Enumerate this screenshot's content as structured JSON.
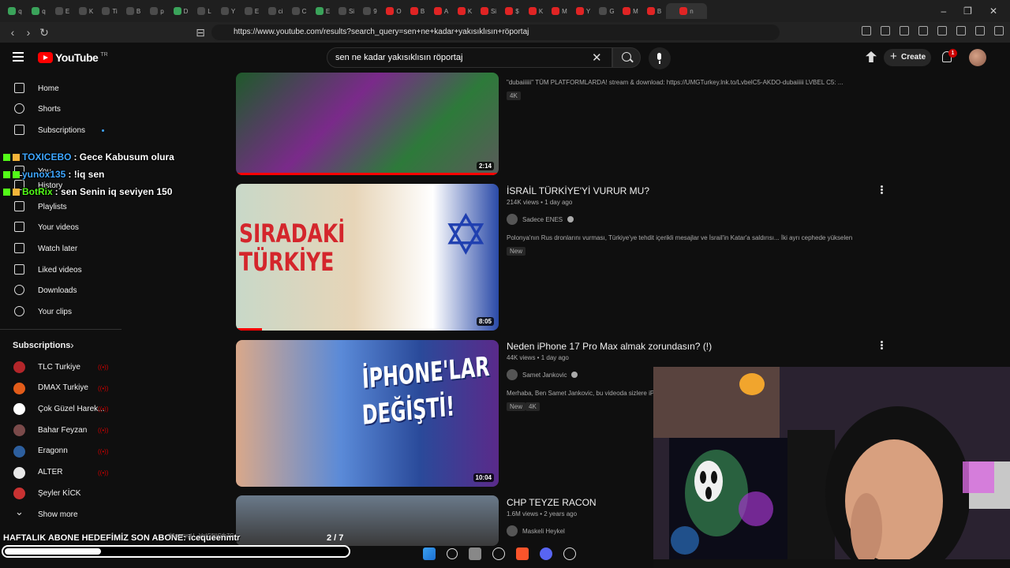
{
  "browser": {
    "tabs": [
      "q",
      "q",
      "E",
      "K",
      "Ti",
      "B",
      "p",
      "D",
      "L",
      "Y",
      "E",
      "ci",
      "C",
      "E",
      "Si",
      "9",
      "O",
      "B",
      "A",
      "K",
      "Si",
      "$",
      "K",
      "M",
      "Y",
      "G",
      "M",
      "B",
      "n"
    ],
    "url": "https://www.youtube.com/results?search_query=sen+ne+kadar+yakısıklısın+röportaj",
    "win_minimize": "–",
    "win_restore": "❐",
    "win_close": "✕"
  },
  "masthead": {
    "logo_text": "YouTube",
    "logo_region": "TR",
    "search_query": "sen ne kadar yakısıklısın röportaj",
    "create_label": "Create",
    "notification_count": "1"
  },
  "sidebar": {
    "items": [
      {
        "label": "Home",
        "icon": "home-icon"
      },
      {
        "label": "Shorts",
        "icon": "shorts-icon"
      },
      {
        "label": "Subscriptions",
        "icon": "subscriptions-icon"
      },
      {
        "label": "You",
        "icon": "you-icon"
      },
      {
        "label": "History",
        "icon": "history-icon"
      },
      {
        "label": "Playlists",
        "icon": "playlists-icon"
      },
      {
        "label": "Your videos",
        "icon": "your-videos-icon"
      },
      {
        "label": "Watch later",
        "icon": "watch-later-icon"
      },
      {
        "label": "Liked videos",
        "icon": "liked-videos-icon"
      },
      {
        "label": "Downloads",
        "icon": "downloads-icon"
      },
      {
        "label": "Your clips",
        "icon": "your-clips-icon"
      }
    ],
    "subscriptions_heading": "Subscriptions",
    "channels": [
      {
        "name": "TLC Turkiye",
        "color": "#b3262a",
        "live": true
      },
      {
        "name": "DMAX Turkiye",
        "color": "#e25c1a",
        "live": true
      },
      {
        "name": "Çok Güzel Harek...",
        "color": "#ffffff",
        "live": true
      },
      {
        "name": "Bahar Feyzan",
        "color": "#7a4a4a",
        "live": true
      },
      {
        "name": "Eragonn",
        "color": "#2d5f9e",
        "live": true
      },
      {
        "name": "ALTER",
        "color": "#e8e8e8",
        "live": true
      },
      {
        "name": "Şeyler KİCK",
        "color": "#c83232",
        "live": false
      }
    ],
    "show_more": "Show more",
    "live_icon": "((•))"
  },
  "chat": [
    {
      "user": "TOXICEBO",
      "message": ": Gece Kabusum olura",
      "color": "blue"
    },
    {
      "user": "yunox135",
      "message": ": !iq sen",
      "color": "blue"
    },
    {
      "user": "BotRix",
      "message": ": sen Senin iq seviyen 150",
      "color": "green"
    }
  ],
  "results": [
    {
      "description": "\"dubaiiiiii\" TÜM PLATFORMLARDA! stream & download: https://UMGTurkey.lnk.to/LvbelC5-AKDO-dubaiiiii LVBEL C5: ...",
      "badges": [
        "4K"
      ],
      "duration": "2:14",
      "watched": 1.0
    },
    {
      "title": "İSRAİL TÜRKİYE'Yİ VURUR MU?",
      "meta": "214K views • 1 day ago",
      "channel": "Sadece ENES",
      "verified": true,
      "description": "Polonya'nın Rus dronlarını vurması, Türkiye'ye tehdit içerikli mesajlar ve İsrail'in Katar'a saldırısı... İki ayrı cephede yükselen ...",
      "badges": [
        "New"
      ],
      "duration": "8:05",
      "thumb_text": [
        "SIRADAKİ",
        "TÜRKİYE"
      ],
      "watched": 0.1
    },
    {
      "title": "Neden iPhone 17 Pro Max almak zorundasın? (!)",
      "meta": "44K views • 1 day ago",
      "channel": "Samet Jankovic",
      "verified": true,
      "description": "Merhaba, Ben Samet Jankovic, bu videoda sizlere iP",
      "badges": [
        "New",
        "4K"
      ],
      "duration": "10:04",
      "thumb_text": [
        "İPHONE'LAR",
        "DEĞİŞTİ!"
      ],
      "watched": 0
    },
    {
      "title": "CHP TEYZE RACON",
      "meta": "1.6M views • 2 years ago",
      "channel": "Maskeli Heykel",
      "verified": false
    }
  ],
  "overlay": {
    "banner": "HAFTALIK ABONE HEDEFİMİZ",
    "banner_tail": "SON ABONE: icequeenmtr",
    "status_url": "...tl&pp=ygU...VuIG5IIGthZG...",
    "counter": "2  / 7",
    "goal_progress": 0.28
  },
  "colors": {
    "background": "#0f0f0f",
    "accent_red": "#ff0000",
    "kick_green": "#53fc18"
  }
}
